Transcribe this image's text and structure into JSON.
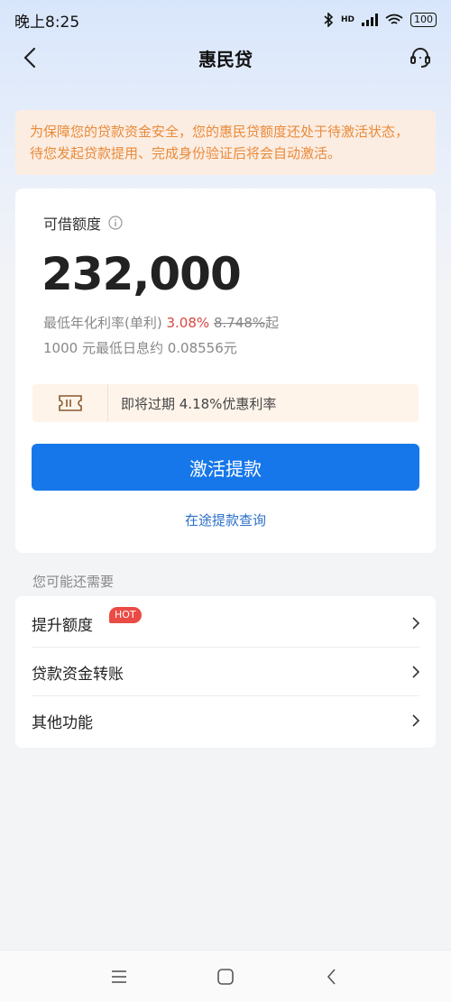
{
  "status_bar": {
    "time": "晚上8:25",
    "network": "HD",
    "battery": "100"
  },
  "nav": {
    "title": "惠民贷"
  },
  "notice": {
    "text": "为保障您的贷款资金安全，您的惠民贷额度还处于待激活状态，待您发起贷款提用、完成身份验证后将会自动激活。"
  },
  "credit": {
    "label": "可借额度",
    "amount": "232,000",
    "rate_prefix": "最低年化利率(单利)",
    "rate_current": "3.08%",
    "rate_old": "8.748%",
    "rate_suffix": "起",
    "interest_text": "1000 元最低日息约 0.08556元"
  },
  "promo": {
    "text": "即将过期 4.18%优惠利率"
  },
  "actions": {
    "activate_label": "激活提款",
    "query_label": "在途提款查询"
  },
  "more": {
    "section_title": "您可能还需要",
    "hot_badge": "HOT",
    "items": [
      {
        "label": "提升额度"
      },
      {
        "label": "贷款资金转账"
      },
      {
        "label": "其他功能"
      }
    ]
  },
  "colors": {
    "accent": "#1677ea",
    "notice_text": "#e98a3a",
    "rate_red": "#d9473f",
    "hot": "#ea4b44"
  },
  "icons": [
    "back-arrow-icon",
    "customer-service-icon",
    "info-icon",
    "coupon-ticket-icon",
    "chevron-right-icon",
    "menu-icon",
    "home-icon",
    "back-icon"
  ]
}
